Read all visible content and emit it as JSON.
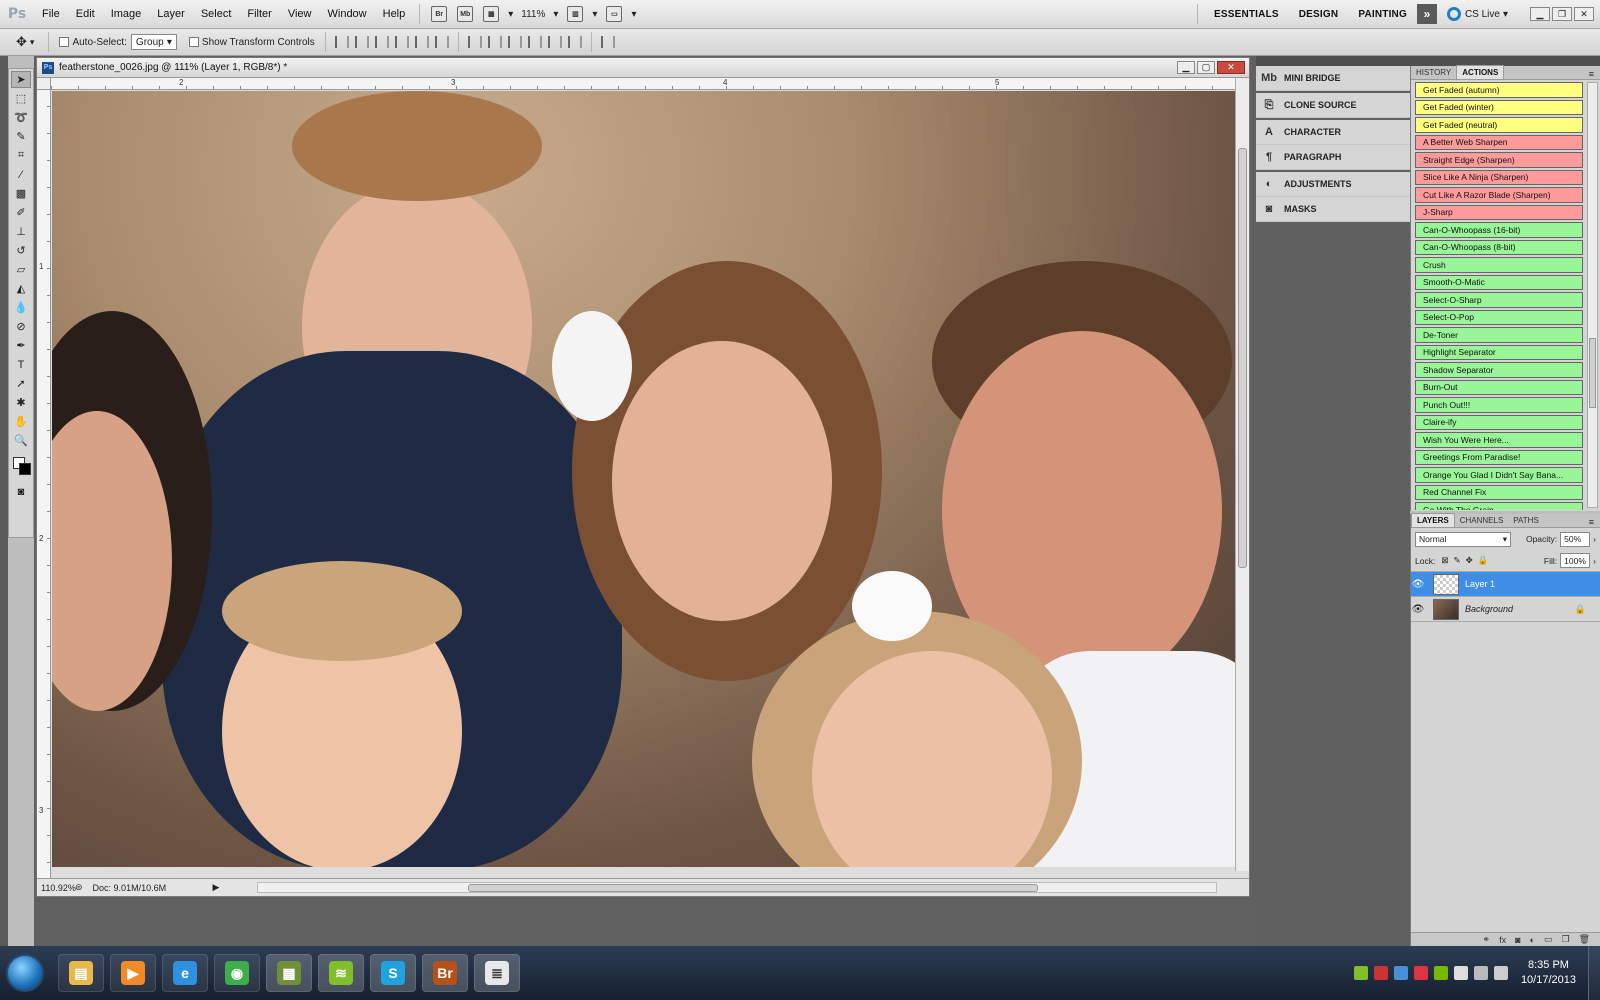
{
  "app": {
    "logo": "Ps",
    "menus": [
      "File",
      "Edit",
      "Image",
      "Layer",
      "Select",
      "Filter",
      "View",
      "Window",
      "Help"
    ],
    "bridge_btn": "Br",
    "minibridge_btn": "Mb",
    "zoom_menu": "111%",
    "workspaces": [
      "ESSENTIALS",
      "DESIGN",
      "PAINTING"
    ],
    "more_btn": "»",
    "cs_live": "CS Live"
  },
  "options": {
    "auto_select_label": "Auto-Select:",
    "auto_select_value": "Group",
    "show_transform_label": "Show Transform Controls"
  },
  "document": {
    "title": "featherstone_0026.jpg @ 111% (Layer 1, RGB/8*) *",
    "zoom": "110.92%",
    "doc_info": "Doc: 9.01M/10.6M",
    "ruler_top": [
      "2",
      "3",
      "4",
      "5"
    ],
    "ruler_left": [
      "1",
      "2",
      "3"
    ]
  },
  "collapsed_panels": [
    [
      {
        "label": "MINI BRIDGE",
        "icon": "Mb"
      }
    ],
    [
      {
        "label": "CLONE SOURCE",
        "icon": "⎘"
      }
    ],
    [
      {
        "label": "CHARACTER",
        "icon": "A"
      },
      {
        "label": "PARAGRAPH",
        "icon": "¶"
      }
    ],
    [
      {
        "label": "ADJUSTMENTS",
        "icon": "◐"
      },
      {
        "label": "MASKS",
        "icon": "◙"
      }
    ]
  ],
  "actions_panel": {
    "tabs": [
      "HISTORY",
      "ACTIONS"
    ],
    "active_tab": "ACTIONS",
    "colors": {
      "yellow": "#ffff80",
      "red": "#ff9b9b",
      "green": "#98f598"
    },
    "actions": [
      {
        "label": "Get Faded (autumn)",
        "color": "yellow"
      },
      {
        "label": "Get Faded (winter)",
        "color": "yellow"
      },
      {
        "label": "Get Faded (neutral)",
        "color": "yellow"
      },
      {
        "label": "A Better Web Sharpen",
        "color": "red"
      },
      {
        "label": "Straight Edge (Sharpen)",
        "color": "red"
      },
      {
        "label": "Slice Like A Ninja (Sharpen)",
        "color": "red"
      },
      {
        "label": "Cut Like A Razor Blade (Sharpen)",
        "color": "red"
      },
      {
        "label": "J-Sharp",
        "color": "red"
      },
      {
        "label": "Can-O-Whoopass (16-bit)",
        "color": "green"
      },
      {
        "label": "Can-O-Whoopass (8-bit)",
        "color": "green"
      },
      {
        "label": "Crush",
        "color": "green"
      },
      {
        "label": "Smooth-O-Matic",
        "color": "green"
      },
      {
        "label": "Select-O-Sharp",
        "color": "green"
      },
      {
        "label": "Select-O-Pop",
        "color": "green"
      },
      {
        "label": "De-Toner",
        "color": "green"
      },
      {
        "label": "Highlight Separator",
        "color": "green"
      },
      {
        "label": "Shadow Separator",
        "color": "green"
      },
      {
        "label": "Burn-Out",
        "color": "green"
      },
      {
        "label": "Punch Out!!!",
        "color": "green"
      },
      {
        "label": "Claire-ify",
        "color": "green"
      },
      {
        "label": "Wish You Were Here...",
        "color": "green"
      },
      {
        "label": "Greetings From Paradise!",
        "color": "green"
      },
      {
        "label": "Orange You Glad I Didn't Say Bana...",
        "color": "green"
      },
      {
        "label": "Red Channel Fix",
        "color": "green"
      },
      {
        "label": "Go With The Grain",
        "color": "green"
      }
    ]
  },
  "layers_panel": {
    "tabs": [
      "LAYERS",
      "CHANNELS",
      "PATHS"
    ],
    "active_tab": "LAYERS",
    "blend_mode": "Normal",
    "opacity_label": "Opacity:",
    "opacity": "50%",
    "lock_label": "Lock:",
    "fill_label": "Fill:",
    "fill": "100%",
    "layers": [
      {
        "name": "Layer 1",
        "active": true,
        "locked": false
      },
      {
        "name": "Background",
        "active": false,
        "locked": true
      }
    ],
    "accent": "#3d8ee4"
  },
  "taskbar": {
    "apps": [
      {
        "name": "explorer",
        "color": "#e8b84a",
        "glyph": "▤"
      },
      {
        "name": "media-player",
        "color": "#f08a24",
        "glyph": "▶"
      },
      {
        "name": "internet-explorer",
        "color": "#2f8fe0",
        "glyph": "e"
      },
      {
        "name": "chrome",
        "color": "#3cae4a",
        "glyph": "◉"
      },
      {
        "name": "minecraft",
        "color": "#6f8f3a",
        "glyph": "▦"
      },
      {
        "name": "spotify",
        "color": "#7fbf2a",
        "glyph": "≋"
      },
      {
        "name": "skype",
        "color": "#1fa3e0",
        "glyph": "S"
      },
      {
        "name": "bridge",
        "color": "#b5521c",
        "glyph": "Br"
      },
      {
        "name": "notepad",
        "color": "#e8e8e8",
        "glyph": "≣"
      }
    ],
    "time": "8:35 PM",
    "date": "10/17/2013"
  }
}
